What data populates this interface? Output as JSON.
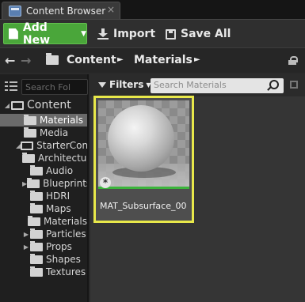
{
  "tab": {
    "title": "Content Browser",
    "close": "×"
  },
  "toolbar": {
    "add_new": "Add New",
    "import": "Import",
    "save_all": "Save All"
  },
  "path": {
    "back": "←",
    "forward": "→",
    "crumbs": [
      "Content",
      "Materials"
    ],
    "sep": "►"
  },
  "folders": {
    "search_placeholder": "Search Fol",
    "tree": [
      {
        "label": "Content",
        "level": 0,
        "arrow": "◢",
        "open": true
      },
      {
        "label": "Materials",
        "level": 1,
        "arrow": "",
        "selected": true
      },
      {
        "label": "Media",
        "level": 1,
        "arrow": ""
      },
      {
        "label": "StarterCont",
        "level": 1,
        "arrow": "◢",
        "open": true
      },
      {
        "label": "Architecture",
        "level": 2,
        "arrow": ""
      },
      {
        "label": "Audio",
        "level": 2,
        "arrow": ""
      },
      {
        "label": "Blueprints",
        "level": 2,
        "arrow": "▶"
      },
      {
        "label": "HDRI",
        "level": 2,
        "arrow": ""
      },
      {
        "label": "Maps",
        "level": 2,
        "arrow": ""
      },
      {
        "label": "Materials",
        "level": 2,
        "arrow": ""
      },
      {
        "label": "Particles",
        "level": 2,
        "arrow": "▶"
      },
      {
        "label": "Props",
        "level": 2,
        "arrow": "▶"
      },
      {
        "label": "Shapes",
        "level": 2,
        "arrow": ""
      },
      {
        "label": "Textures",
        "level": 2,
        "arrow": ""
      }
    ]
  },
  "assets": {
    "filters_label": "Filters",
    "search_placeholder": "Search Materials",
    "items": [
      {
        "name": "MAT_Subsurface_00",
        "badge": "*"
      }
    ]
  },
  "colors": {
    "accent_add": "#4aa63a",
    "selection": "#e8e84a",
    "type_bar": "#3cb43c"
  }
}
